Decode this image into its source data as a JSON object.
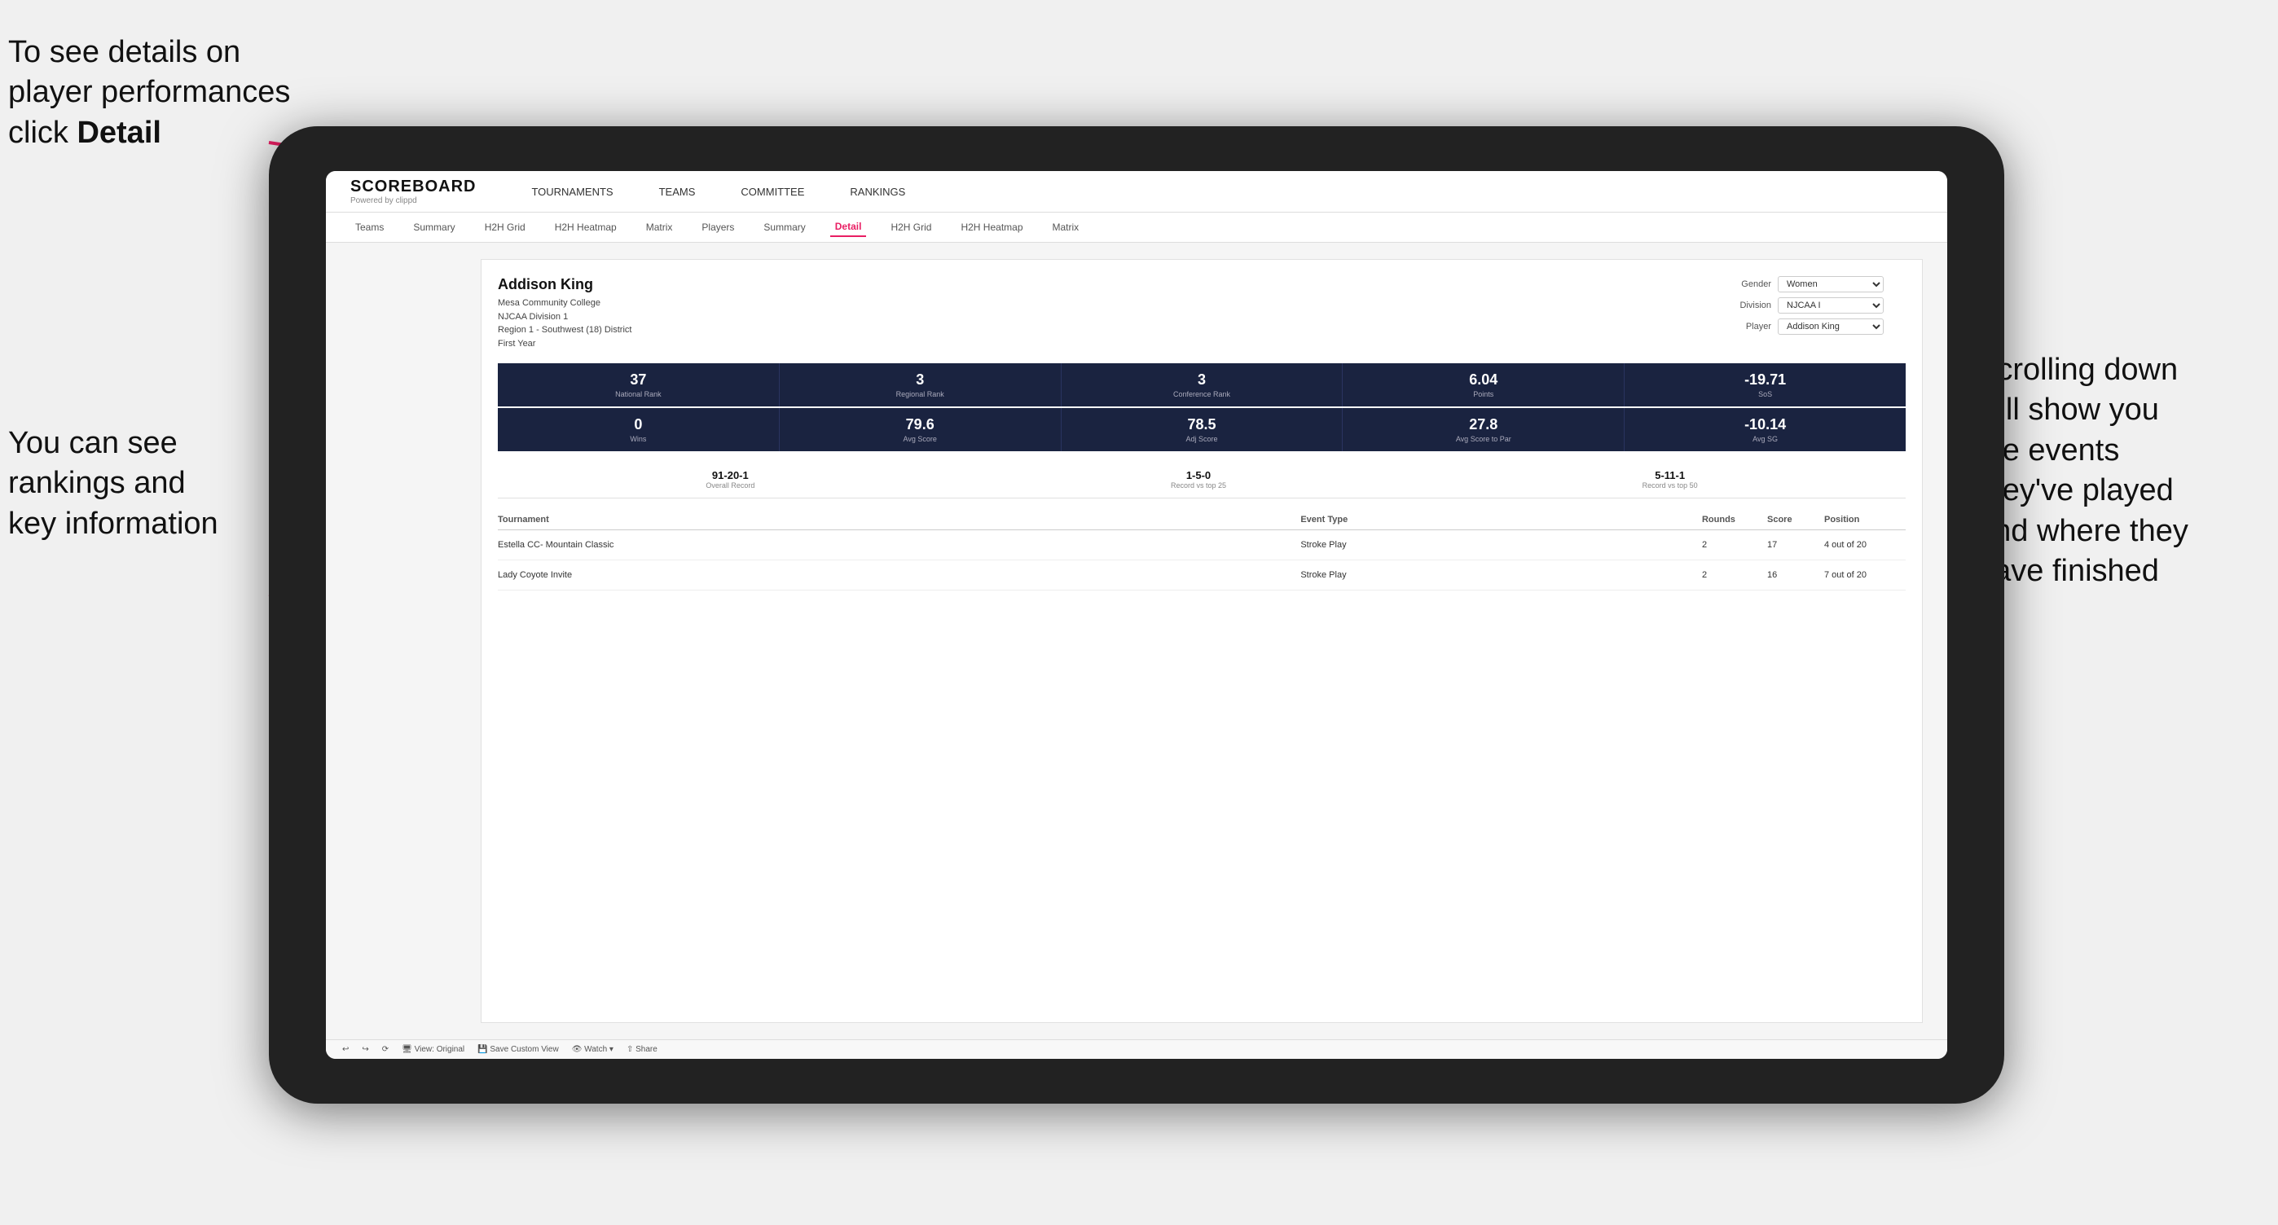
{
  "annotations": {
    "top_left": {
      "line1": "To see details on",
      "line2": "player performances",
      "line3_plain": "click ",
      "line3_bold": "Detail"
    },
    "bottom_left": {
      "line1": "You can see",
      "line2": "rankings and",
      "line3": "key information"
    },
    "right": {
      "line1": "Scrolling down",
      "line2": "will show you",
      "line3": "the events",
      "line4": "they've played",
      "line5": "and where they",
      "line6": "have finished"
    }
  },
  "nav": {
    "logo": "SCOREBOARD",
    "logo_sub": "Powered by clippd",
    "items": [
      "TOURNAMENTS",
      "TEAMS",
      "COMMITTEE",
      "RANKINGS"
    ]
  },
  "sub_nav": {
    "items": [
      "Teams",
      "Summary",
      "H2H Grid",
      "H2H Heatmap",
      "Matrix",
      "Players",
      "Summary",
      "Detail",
      "H2H Grid",
      "H2H Heatmap",
      "Matrix"
    ],
    "active": "Detail"
  },
  "player": {
    "name": "Addison King",
    "school": "Mesa Community College",
    "division": "NJCAA Division 1",
    "region": "Region 1 - Southwest (18) District",
    "year": "First Year",
    "gender_label": "Gender",
    "gender_value": "Women",
    "division_label": "Division",
    "division_value": "NJCAA I",
    "player_label": "Player",
    "player_value": "Addison King"
  },
  "stats_row1": [
    {
      "value": "37",
      "label": "National Rank"
    },
    {
      "value": "3",
      "label": "Regional Rank"
    },
    {
      "value": "3",
      "label": "Conference Rank"
    },
    {
      "value": "6.04",
      "label": "Points"
    },
    {
      "value": "-19.71",
      "label": "SoS"
    }
  ],
  "stats_row2": [
    {
      "value": "0",
      "label": "Wins"
    },
    {
      "value": "79.6",
      "label": "Avg Score"
    },
    {
      "value": "78.5",
      "label": "Adj Score"
    },
    {
      "value": "27.8",
      "label": "Avg Score to Par"
    },
    {
      "value": "-10.14",
      "label": "Avg SG"
    }
  ],
  "records": [
    {
      "value": "91-20-1",
      "label": "Overall Record"
    },
    {
      "value": "1-5-0",
      "label": "Record vs top 25"
    },
    {
      "value": "5-11-1",
      "label": "Record vs top 50"
    }
  ],
  "table": {
    "headers": [
      "Tournament",
      "Event Type",
      "Rounds",
      "Score",
      "Position"
    ],
    "rows": [
      {
        "tournament": "Estella CC- Mountain Classic",
        "event_type": "Stroke Play",
        "rounds": "2",
        "score": "17",
        "position": "4 out of 20"
      },
      {
        "tournament": "Lady Coyote Invite",
        "event_type": "Stroke Play",
        "rounds": "2",
        "score": "16",
        "position": "7 out of 20"
      }
    ]
  },
  "toolbar": {
    "buttons": [
      "View: Original",
      "Save Custom View",
      "Watch",
      "Share"
    ]
  }
}
